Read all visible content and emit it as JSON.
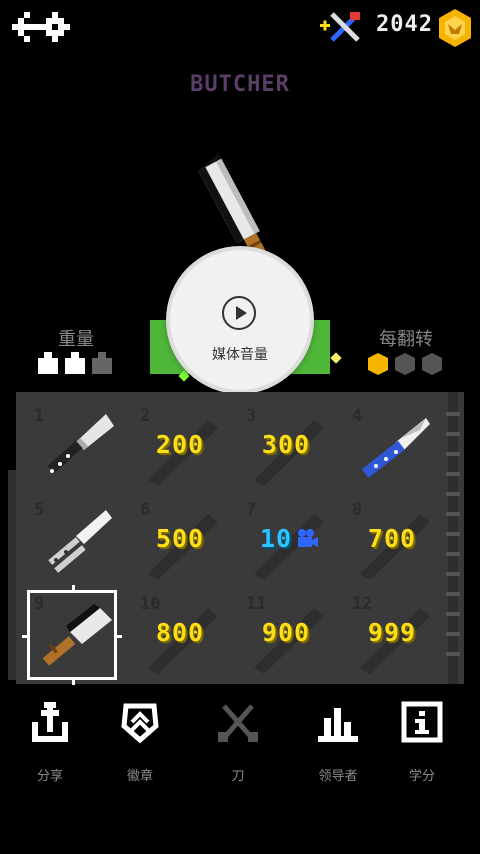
{
  "header": {
    "coins": "2042"
  },
  "knife": {
    "name": "BUTCHER",
    "weight_label": "重量",
    "weight_level": 2,
    "weight_max": 3,
    "flip_label": "每翻转",
    "flip_reward": 1,
    "flip_max": 3
  },
  "media": {
    "label": "媒体音量"
  },
  "grid": [
    {
      "number": "1",
      "state": "owned",
      "price": ""
    },
    {
      "number": "2",
      "state": "locked",
      "price": "200"
    },
    {
      "number": "3",
      "state": "locked",
      "price": "300"
    },
    {
      "number": "4",
      "state": "owned",
      "price": ""
    },
    {
      "number": "5",
      "state": "owned",
      "price": ""
    },
    {
      "number": "6",
      "state": "locked",
      "price": "500"
    },
    {
      "number": "7",
      "state": "video",
      "price": "10"
    },
    {
      "number": "8",
      "state": "locked",
      "price": "700"
    },
    {
      "number": "9",
      "state": "selected",
      "price": ""
    },
    {
      "number": "10",
      "state": "locked",
      "price": "800"
    },
    {
      "number": "11",
      "state": "locked",
      "price": "900"
    },
    {
      "number": "12",
      "state": "locked",
      "price": "999"
    }
  ],
  "nav": {
    "share": "分享",
    "badges": "徽章",
    "knives": "刀",
    "leaders": "领导者",
    "credits": "学分"
  },
  "colors": {
    "price": "#ffde17",
    "video": "#2ec4ff",
    "accent_green": "#4fb83a",
    "coin": "#f5b400"
  }
}
